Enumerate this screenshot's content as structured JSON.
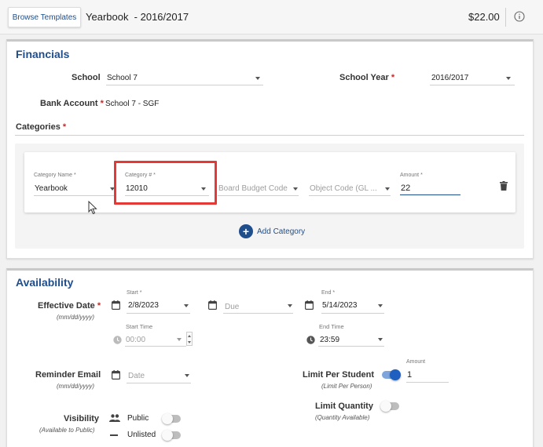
{
  "header": {
    "browse_label": "Browse Templates",
    "title": "Yearbook  - 2016/2017",
    "price": "$22.00"
  },
  "financials": {
    "section_title": "Financials",
    "school_label": "School",
    "school_value": "School 7",
    "school_year_label": "School Year",
    "school_year_value": "2016/2017",
    "bank_label": "Bank Account",
    "bank_value": "School 7 - SGF",
    "categories_label": "Categories",
    "required_mark": "*",
    "category": {
      "name_label": "Category Name *",
      "name_value": "Yearbook",
      "num_label": "Category # *",
      "num_value": "12010",
      "budget_placeholder": "Board Budget Code",
      "object_placeholder": "Object Code (GL ...",
      "amount_label": "Amount *",
      "amount_value": "22"
    },
    "add_category_label": "Add Category"
  },
  "availability": {
    "section_title": "Availability",
    "effective_label": "Effective Date",
    "effective_sub": "(mm/dd/yyyy)",
    "start_label": "Start *",
    "start_value": "2/8/2023",
    "due_placeholder": "Due",
    "end_label": "End *",
    "end_value": "5/14/2023",
    "start_time_label": "Start Time",
    "start_time_value": "00:00",
    "end_time_label": "End Time",
    "end_time_value": "23:59",
    "reminder_label": "Reminder Email",
    "reminder_sub": "(mm/dd/yyyy)",
    "reminder_placeholder": "Date",
    "limit_student_label": "Limit Per Student",
    "limit_student_sub": "(Limit Per Person)",
    "limit_student_on": true,
    "amount_label": "Amount",
    "amount_value": "1",
    "limit_qty_label": "Limit Quantity",
    "limit_qty_sub": "(Quantity Available)",
    "limit_qty_on": false,
    "visibility_label": "Visibility",
    "visibility_sub": "(Available to Public)",
    "public_label": "Public",
    "public_on": false,
    "unlisted_label": "Unlisted",
    "unlisted_on": false
  },
  "colors": {
    "accent": "#1f4e8c",
    "required": "#c62828",
    "highlight": "#e53935",
    "toggle_on": "#1f5fbf"
  },
  "icons": [
    "info-icon",
    "caret-down-icon",
    "calendar-icon",
    "clock-icon",
    "trash-icon",
    "plus-icon",
    "people-icon",
    "dash-icon",
    "cursor-icon"
  ]
}
